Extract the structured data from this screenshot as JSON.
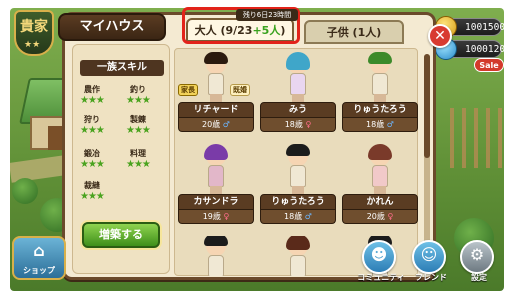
{
  "crest": {
    "text": "貴家",
    "stars": "★★"
  },
  "resources": [
    {
      "value": "1001500",
      "icon": "gold-coin-icon"
    },
    {
      "value": "1000120",
      "icon": "gem-icon"
    }
  ],
  "sale_badge": "Sale",
  "panel": {
    "title": "マイハウス"
  },
  "tabs": {
    "adult_prefix": "大人 (9/23",
    "adult_plus": "+5人",
    "adult_suffix": ")",
    "child": "子供 (1人)",
    "timer": "残り6日23時間"
  },
  "skills": {
    "header": "一族スキル",
    "items": [
      {
        "name": "農作",
        "stars": "★★★"
      },
      {
        "name": "釣り",
        "stars": "★★★"
      },
      {
        "name": "狩り",
        "stars": "★★★"
      },
      {
        "name": "製錬",
        "stars": "★★★"
      },
      {
        "name": "鍛冶",
        "stars": "★★★"
      },
      {
        "name": "料理",
        "stars": "★★★"
      },
      {
        "name": "裁縫",
        "stars": "★★★"
      }
    ],
    "build_button": "増築する"
  },
  "people": [
    {
      "name": "リチャード",
      "age": "20歳",
      "sex": "♂",
      "hair": "#2b1a0e",
      "tag_head": "家長",
      "tag_married": "既婚"
    },
    {
      "name": "みう",
      "age": "18歳",
      "sex": "♀",
      "hair": "#3fa6c9"
    },
    {
      "name": "りゅうたろう",
      "age": "18歳",
      "sex": "♂",
      "hair": "#3d8a2a"
    },
    {
      "name": "カサンドラ",
      "age": "19歳",
      "sex": "♀",
      "hair": "#7a3ba8"
    },
    {
      "name": "りゅうたろう",
      "age": "18歳",
      "sex": "♂",
      "hair": "#1c1c1c"
    },
    {
      "name": "かれん",
      "age": "20歳",
      "sex": "♀",
      "hair": "#7a3a2a"
    }
  ],
  "bottom": {
    "shop": "ショップ",
    "community": "コミュニティ",
    "friend": "フレンド",
    "settings": "設定"
  },
  "colors": {
    "highlight": "#e2231a",
    "panel": "#f4ead2",
    "accent_green": "#3aa21f"
  }
}
